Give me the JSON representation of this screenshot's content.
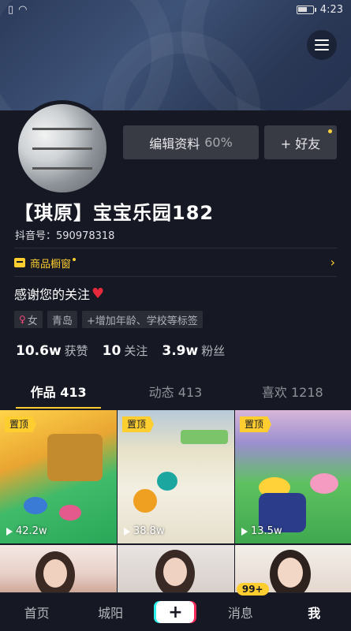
{
  "status_bar": {
    "time": "4:23"
  },
  "profile": {
    "edit_label": "编辑资料",
    "edit_percent": "60%",
    "add_friend_label": "+ 好友",
    "name": "【琪原】宝宝乐园182",
    "douyin_id": "抖音号：590978318",
    "shop_label": "商品橱窗",
    "bio": "感谢您的关注",
    "tags": [
      "女",
      "青岛",
      "+增加年龄、学校等标签"
    ],
    "stats": [
      {
        "value": "10.6w",
        "label": "获赞"
      },
      {
        "value": "10",
        "label": "关注"
      },
      {
        "value": "3.9w",
        "label": "粉丝"
      }
    ]
  },
  "tabs": [
    {
      "label": "作品 413"
    },
    {
      "label": "动态 413"
    },
    {
      "label": "喜欢 1218"
    }
  ],
  "videos": [
    {
      "pinned": "置顶",
      "views": "42.2w"
    },
    {
      "pinned": "置顶",
      "views": "38.8w"
    },
    {
      "pinned": "置顶",
      "views": "13.5w"
    }
  ],
  "bottom_nav": {
    "home": "首页",
    "city": "城阳",
    "create": "+",
    "messages": "消息",
    "messages_badge": "99+",
    "me": "我"
  },
  "colors": {
    "accent": "#fece30",
    "background": "#161823",
    "heart": "#e62a3c"
  }
}
